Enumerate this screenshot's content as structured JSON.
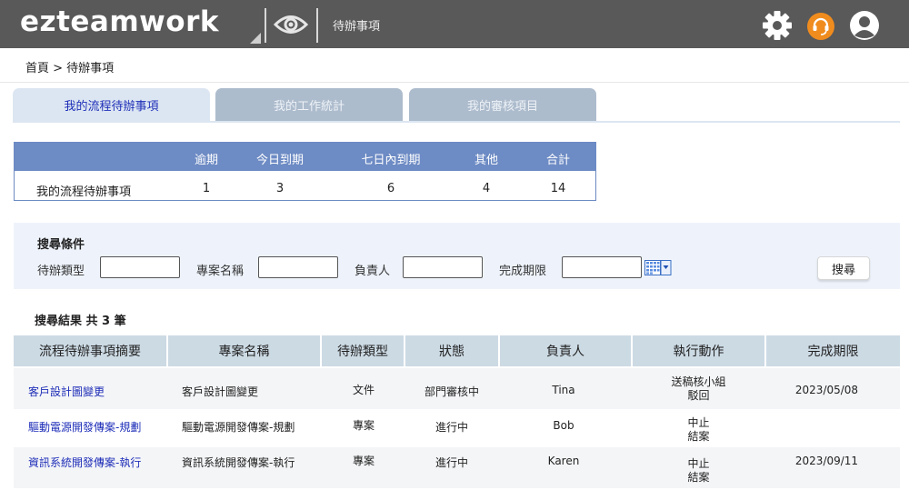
{
  "header": {
    "logo_text": "ezteamwork",
    "page_label": "待辦事項",
    "icons": [
      "eye-icon",
      "gear-icon",
      "headset-icon",
      "user-icon"
    ],
    "colors": {
      "bar": "#595959",
      "headset": "#f08c1e"
    }
  },
  "breadcrumb": "首頁 > 待辦事項",
  "tabs": [
    {
      "label": "我的流程待辦事項",
      "active": true
    },
    {
      "label": "我的工作統計",
      "active": false
    },
    {
      "label": "我的審核項目",
      "active": false
    }
  ],
  "summary": {
    "headers": [
      "",
      "逾期",
      "今日到期",
      "七日內到期",
      "其他",
      "合計"
    ],
    "row": [
      "我的流程待辦事項",
      "1",
      "3",
      "6",
      "4",
      "14"
    ]
  },
  "search": {
    "title": "搜尋條件",
    "fields": [
      {
        "label": "待辦類型",
        "value": ""
      },
      {
        "label": "專案名稱",
        "value": ""
      },
      {
        "label": "負責人",
        "value": ""
      },
      {
        "label": "完成期限",
        "value": ""
      }
    ],
    "button": "搜尋"
  },
  "results": {
    "title": "搜尋結果 共 3 筆",
    "headers": [
      "流程待辦事項摘要",
      "專案名稱",
      "待辦類型",
      "狀態",
      "負責人",
      "執行動作",
      "完成期限"
    ],
    "rows": [
      {
        "summary": "客戶設計圖變更",
        "project": "客戶設計圖變更",
        "type": "文件",
        "status": "部門審核中",
        "owner": "Tina",
        "action1": "送稿核小組",
        "action2": "駁回",
        "due": "2023/05/08"
      },
      {
        "summary": "驅動電源開發傳案-規劃",
        "project": "驅動電源開發傳案-規劃",
        "type": "專案",
        "status": "進行中",
        "owner": "Bob",
        "action1": "中止",
        "action2": "結案",
        "due": ""
      },
      {
        "summary": "資訊系統開發傳案-執行",
        "project": "資訊系統開發傳案-執行",
        "type": "專案",
        "status": "進行中",
        "owner": "Karen",
        "action1": "中止",
        "action2": "結案",
        "due": "2023/09/11"
      }
    ]
  }
}
